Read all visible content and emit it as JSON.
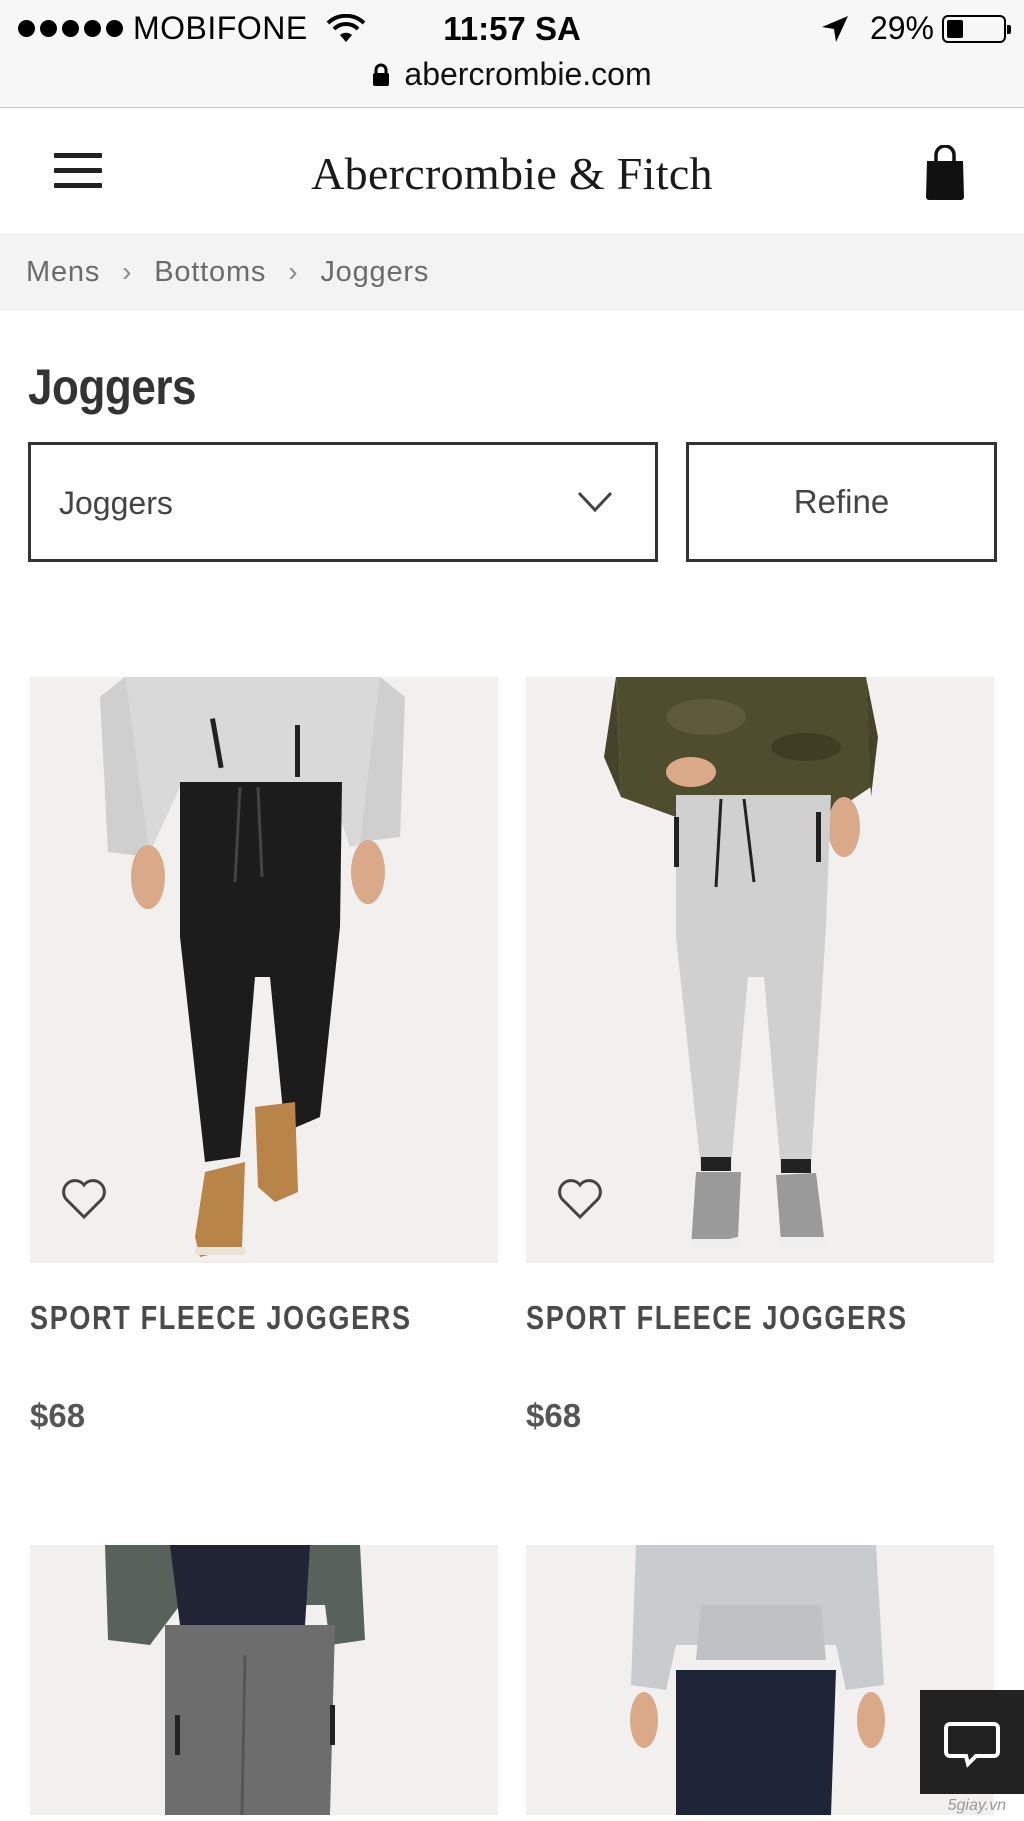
{
  "status_bar": {
    "carrier": "MOBIFONE",
    "time": "11:57 SA",
    "battery_percent": "29%",
    "battery_level": 0.29,
    "url": "abercrombie.com"
  },
  "header": {
    "logo": "Abercrombie & Fitch"
  },
  "breadcrumb": {
    "items": [
      "Mens",
      "Bottoms",
      "Joggers"
    ]
  },
  "page": {
    "title": "Joggers",
    "category_select_value": "Joggers",
    "refine_label": "Refine"
  },
  "products": [
    {
      "name": "SPORT FLEECE JOGGERS",
      "price": "$68",
      "image": "man in light grey hoodie and black joggers with tan sneakers"
    },
    {
      "name": "SPORT FLEECE JOGGERS",
      "price": "$68",
      "image": "man in olive camo hoodie and light grey joggers with grey sneakers"
    }
  ],
  "lower_products": [
    {
      "image": "man in green zip jacket and heather grey joggers"
    },
    {
      "image": "man in light grey hoodie and navy joggers"
    }
  ],
  "watermark": "5giay.vn",
  "icons": {
    "menu": "hamburger-menu-icon",
    "bag": "shopping-bag-icon",
    "wishlist": "heart-icon",
    "chat": "chat-bubble-icon"
  }
}
